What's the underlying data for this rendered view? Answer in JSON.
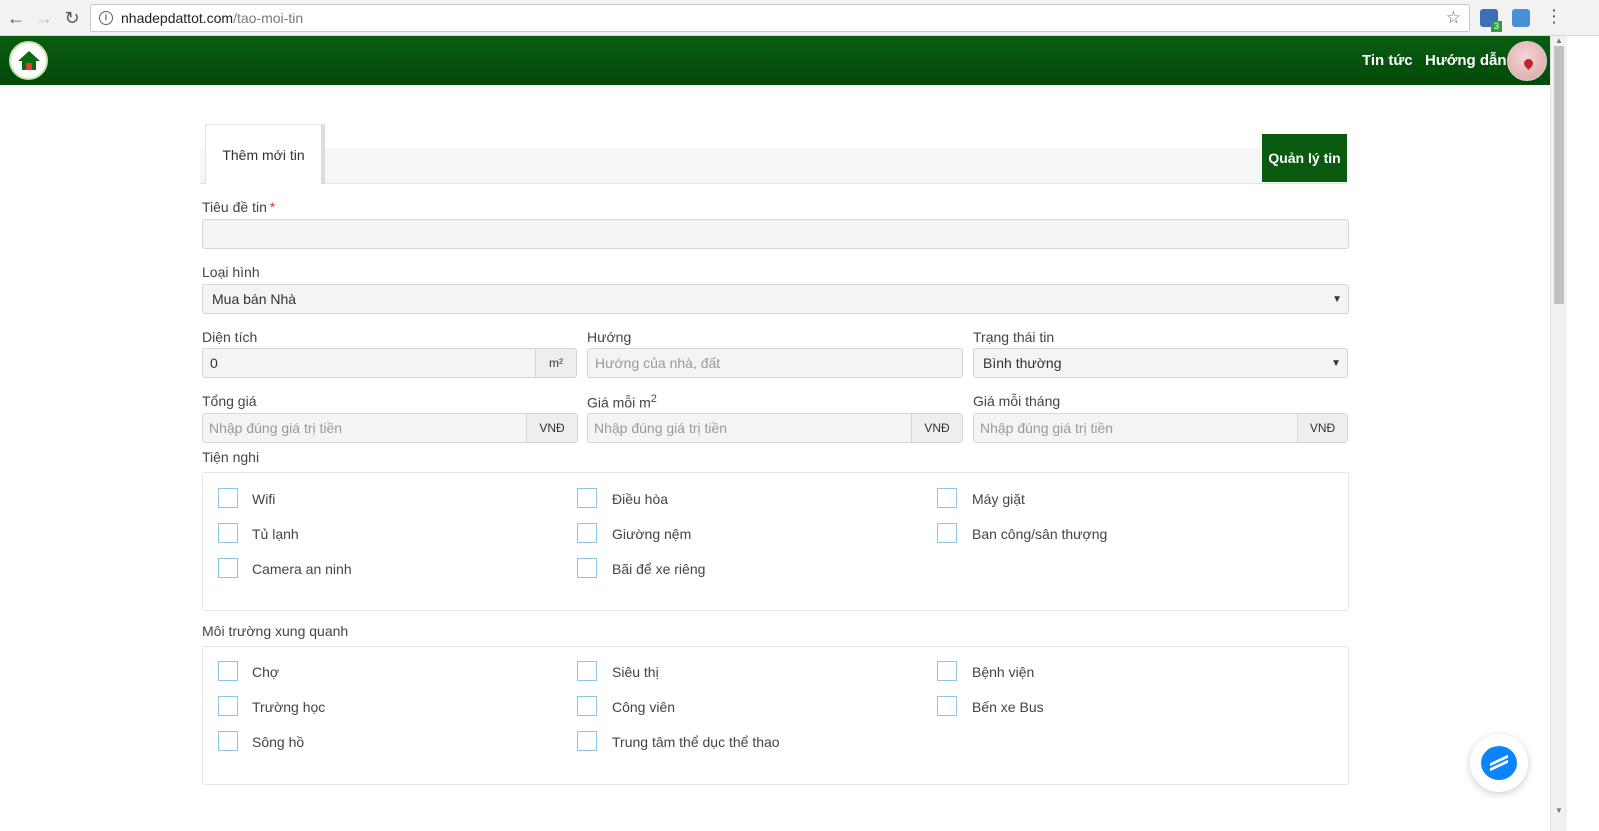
{
  "browser": {
    "url_domain": "nhadepdattot.com",
    "url_path": "/tao-moi-tin",
    "ext_badge": "3"
  },
  "header": {
    "nav": [
      "Tin tức",
      "Hướng dẫn"
    ]
  },
  "tabs": {
    "active": "Thêm mới tin",
    "manage_button": "Quản lý tin"
  },
  "form": {
    "title_label": "Tiêu đề tin",
    "required_mark": "*",
    "title_value": "",
    "type_label": "Loại hình",
    "type_value": "Mua bán Nhà",
    "area_label": "Diện tích",
    "area_value": "0",
    "area_unit": "m²",
    "direction_label": "Hướng",
    "direction_placeholder": "Hướng của nhà, đất",
    "status_label": "Trạng thái tin",
    "status_value": "Bình thường",
    "total_price_label": "Tổng giá",
    "price_per_m2_label": "Giá mỗi m",
    "price_per_m2_sup": "2",
    "monthly_price_label": "Giá mỗi tháng",
    "price_placeholder": "Nhập đúng giá trị tiền",
    "currency": "VNĐ",
    "amenities_label": "Tiện nghi",
    "amenities": [
      "Wifi",
      "Điều hòa",
      "Máy giặt",
      "Tủ lạnh",
      "Giường nệm",
      "Ban công/sân thượng",
      "Camera an ninh",
      "Bãi để xe riêng"
    ],
    "environment_label": "Môi trường xung quanh",
    "environment": [
      "Chợ",
      "Siêu thị",
      "Bệnh viện",
      "Trường học",
      "Công viên",
      "Bến xe Bus",
      "Sông hồ",
      "Trung tâm thể dục thể thao"
    ]
  }
}
